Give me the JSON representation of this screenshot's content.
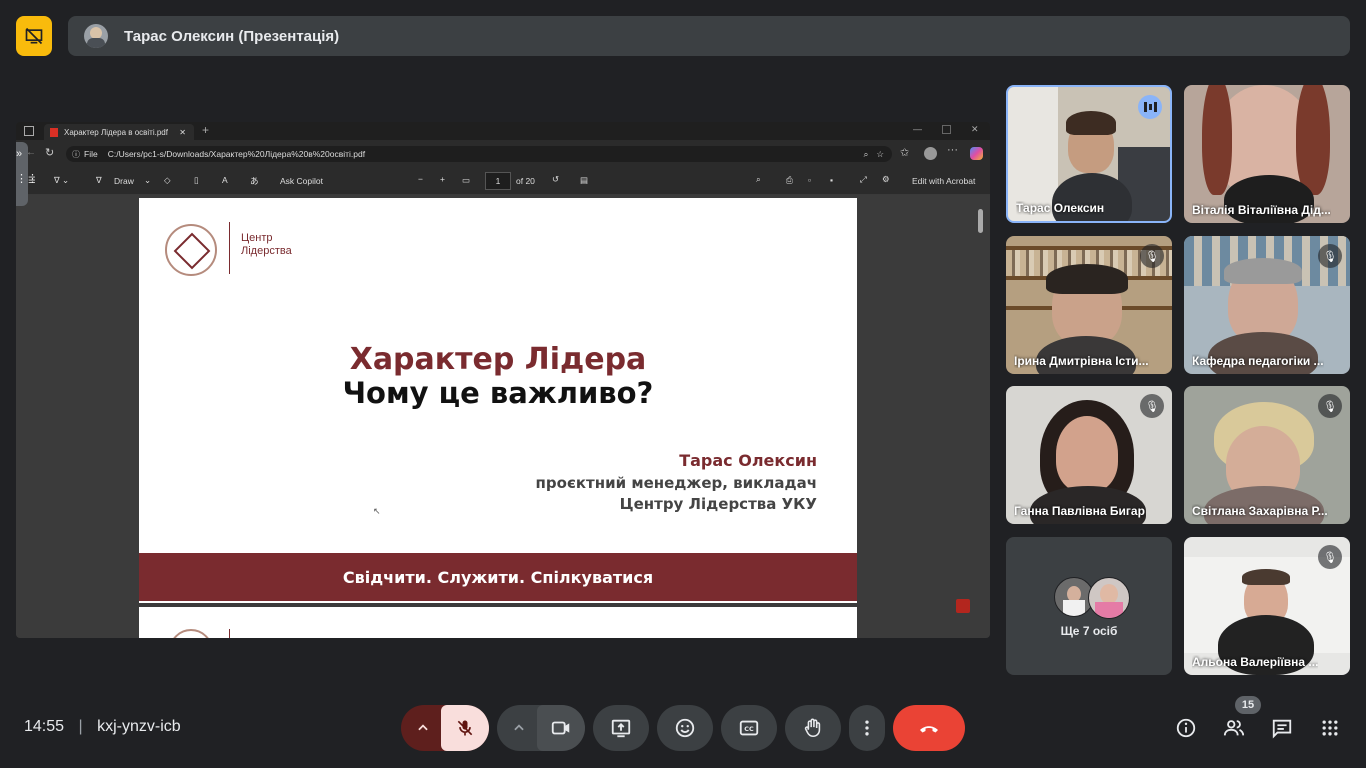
{
  "presenter_bar": {
    "name": "Тарас Олексин (Презентація)"
  },
  "browser": {
    "tab_title": "Характер Лідера в освіті.pdf",
    "url_prefix": "File",
    "url": "C:/Users/pc1-s/Downloads/Характер%20Лідера%20в%20освіті.pdf",
    "toolbar": {
      "draw_label": "Draw",
      "ask_copilot_label": "Ask Copilot",
      "page_number": "1",
      "page_total": "of 20",
      "edit_acrobat_label": "Edit with Acrobat"
    }
  },
  "slide": {
    "logo_text": "Центр Лідерства",
    "title": "Характер Лідера",
    "subtitle": "Чому це важливо?",
    "author": "Тарас Олексин",
    "role_line1": "проєктний менеджер, викладач",
    "role_line2": "Центру Лідерства УКУ",
    "footer": "Свідчити. Служити. Спілкуватися"
  },
  "participants": [
    {
      "name": "Тарас Олексин",
      "state": "speaking"
    },
    {
      "name": "Віталія Віталіївна Дід..."
    },
    {
      "name": "Ірина Дмитрівна Істи...",
      "state": "muted"
    },
    {
      "name": "Кафедра педагогіки ...",
      "state": "muted"
    },
    {
      "name": "Ганна Павлівна Бигар",
      "state": "muted"
    },
    {
      "name": "Світлана Захарівна Р...",
      "state": "muted"
    },
    {
      "name": "Альона Валеріївна ...",
      "state": "muted"
    }
  ],
  "more_participants": "Ще 7 осіб",
  "bottom_bar": {
    "time": "14:55",
    "meeting_code": "kxj-ynzv-icb",
    "people_count": "15"
  },
  "colors": {
    "background": "#202124",
    "stop_button": "#f9bb0c",
    "end_call": "#ea4335",
    "mic_off_bg": "#f9dedc",
    "brand_red": "#7a2b2f"
  }
}
